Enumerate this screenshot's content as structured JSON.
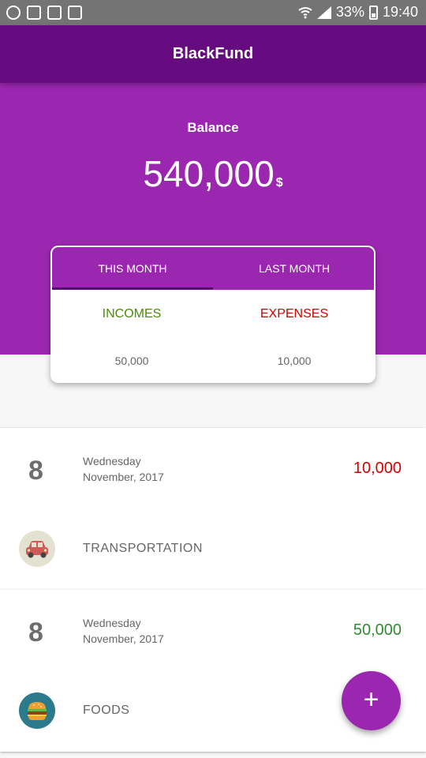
{
  "status_bar": {
    "battery": "33%",
    "time": "19:40"
  },
  "app": {
    "title": "BlackFund"
  },
  "balance": {
    "label": "Balance",
    "amount": "540,000",
    "currency": "$"
  },
  "summary_card": {
    "tabs": [
      {
        "label": "THIS MONTH",
        "selected": true
      },
      {
        "label": "LAST MONTH",
        "selected": false
      }
    ],
    "incomes": {
      "label": "INCOMES",
      "value": "50,000",
      "color": "#4c8c00"
    },
    "expenses": {
      "label": "EXPENSES",
      "value": "10,000",
      "color": "#d50000"
    }
  },
  "entries": [
    {
      "day": "8",
      "weekday": "Wednesday",
      "month_year": "November, 2017",
      "amount": "10,000",
      "amount_color": "#d50000",
      "category": "TRANSPORTATION",
      "icon": "car-icon"
    },
    {
      "day": "8",
      "weekday": "Wednesday",
      "month_year": "November, 2017",
      "amount": "50,000",
      "amount_color": "#2e8b2e",
      "category": "FOODS",
      "icon": "burger-icon"
    }
  ],
  "fab": {
    "label": "+"
  },
  "colors": {
    "primary": "#9b27b0",
    "primary_dark": "#660a80",
    "status_bar": "#747474"
  }
}
